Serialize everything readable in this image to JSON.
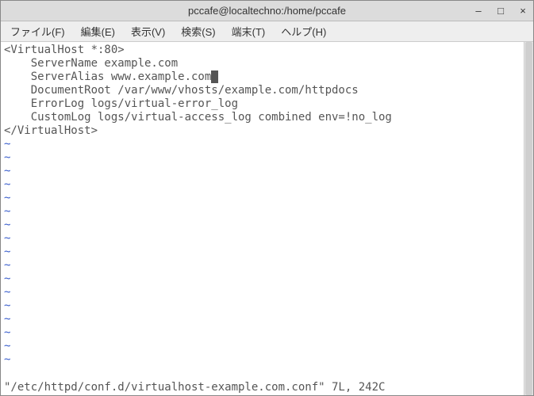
{
  "titlebar": {
    "title": "pccafe@localtechno:/home/pccafe",
    "minimize": "–",
    "maximize": "□",
    "close": "×"
  },
  "menubar": {
    "file": "ファイル(F)",
    "edit": "編集(E)",
    "view": "表示(V)",
    "search": "検索(S)",
    "terminal": "端末(T)",
    "help": "ヘルプ(H)"
  },
  "editor": {
    "lines": [
      "<VirtualHost *:80>",
      "    ServerName example.com",
      "    ServerAlias www.example.com",
      "    DocumentRoot /var/www/vhosts/example.com/httpdocs",
      "    ErrorLog logs/virtual-error_log",
      "    CustomLog logs/virtual-access_log combined env=!no_log",
      "</VirtualHost>"
    ],
    "cursor": {
      "line": 2,
      "col": 31
    },
    "tilde": "~",
    "status": "\"/etc/httpd/conf.d/virtualhost-example.com.conf\" 7L, 242C"
  }
}
